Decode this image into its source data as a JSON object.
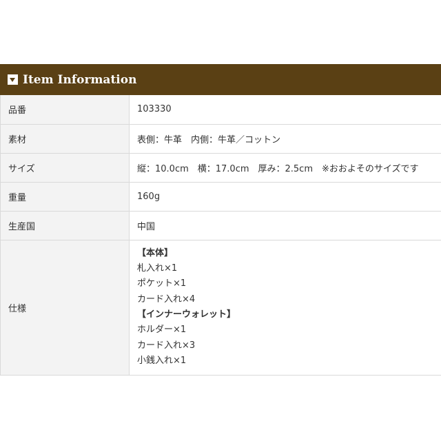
{
  "header": {
    "title": "Item Information",
    "icon": "caret-down-square-icon"
  },
  "rows": [
    {
      "label": "品番",
      "value": "103330"
    },
    {
      "label": "素材",
      "value": "表側：牛革　内側：牛革／コットン"
    },
    {
      "label": "サイズ",
      "value": "縦：10.0cm　横：17.0cm　厚み：2.5cm　※おおよそのサイズです"
    },
    {
      "label": "重量",
      "value": "160g"
    },
    {
      "label": "生産国",
      "value": "中国"
    }
  ],
  "spec": {
    "label": "仕様",
    "lines": [
      "【本体】",
      "札入れ×1",
      "ポケット×1",
      "カード入れ×4",
      "【インナーウォレット】",
      "ホルダー×1",
      "カード入れ×3",
      "小銭入れ×1"
    ]
  },
  "colors": {
    "header_bg": "#5a4014",
    "label_bg": "#f3f3f3",
    "border": "#d9d9d9"
  }
}
